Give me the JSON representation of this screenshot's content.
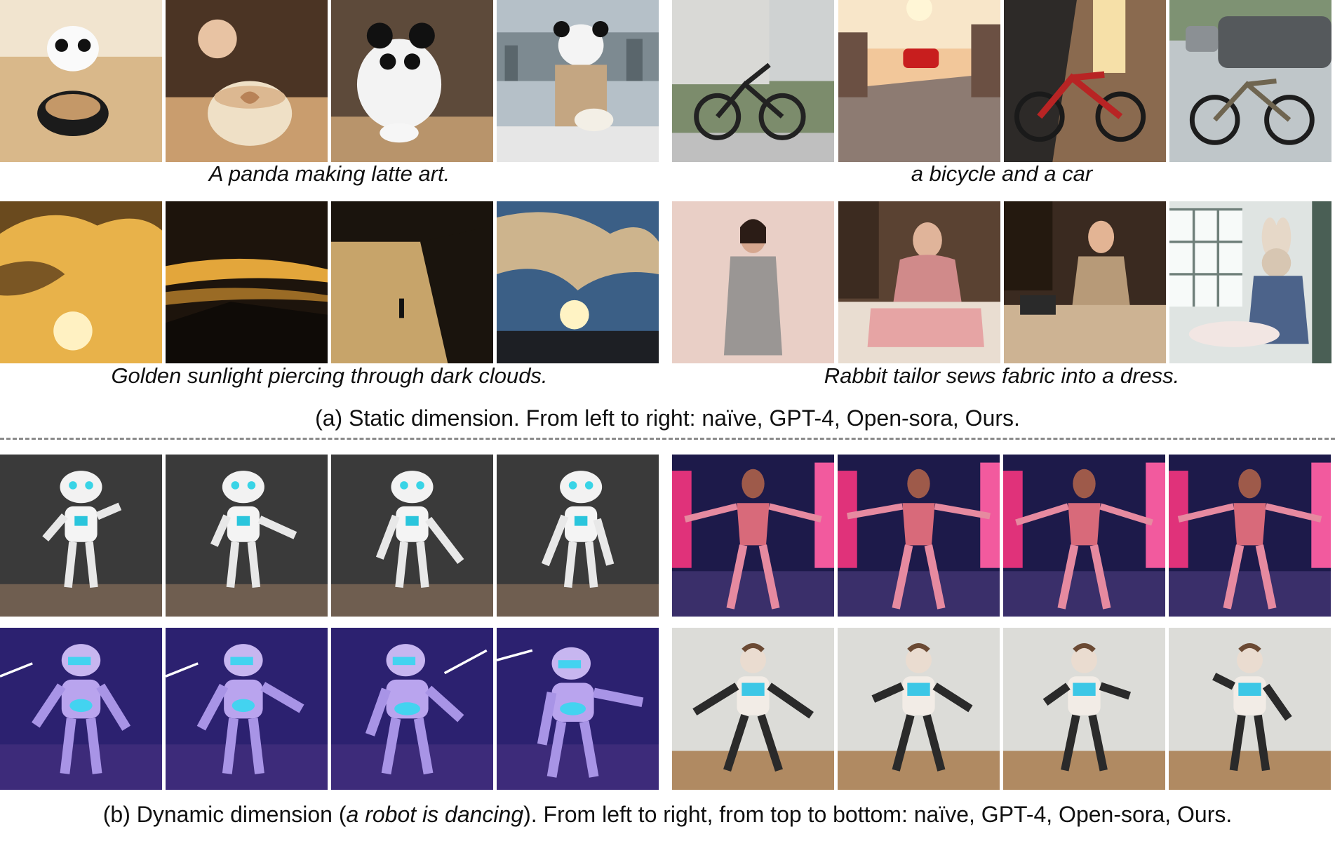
{
  "static_section": {
    "captions": [
      "A panda making latte art.",
      "a bicycle and a car",
      "Golden sunlight piercing through dark clouds.",
      "Rabbit tailor sews fabric into a dress."
    ],
    "subcaption": "(a) Static dimension. From left to right: naïve, GPT-4, Open-sora, Ours."
  },
  "dynamic_section": {
    "subcaption_prefix": "(b) Dynamic dimension (",
    "subcaption_prompt": "a robot is dancing",
    "subcaption_suffix": "). From left to right, from top to bottom: naïve, GPT-4, Open-sora, Ours."
  },
  "colors": {
    "divider": "#8a8a8a",
    "caption_text": "#111111"
  }
}
